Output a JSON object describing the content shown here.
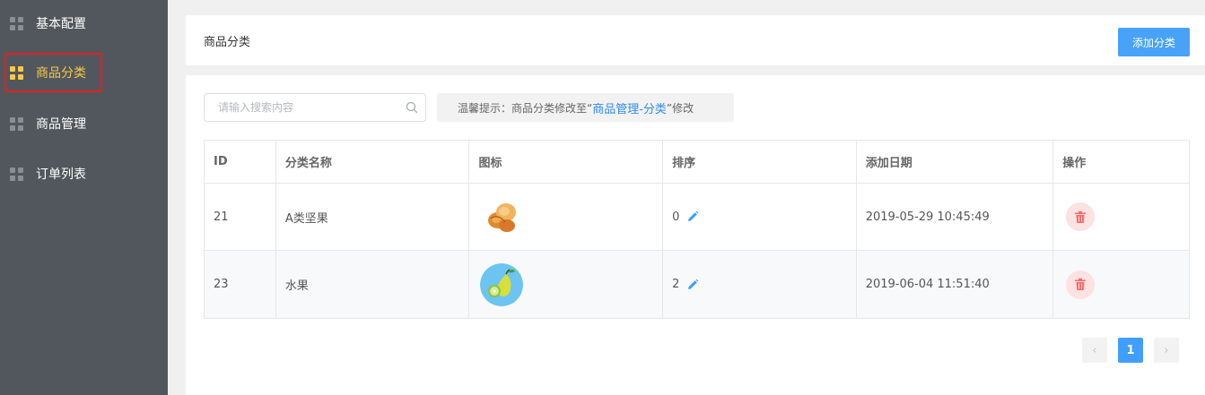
{
  "sidebar": {
    "items": [
      {
        "label": "基本配置",
        "active": false
      },
      {
        "label": "商品分类",
        "active": true
      },
      {
        "label": "商品管理",
        "active": false
      },
      {
        "label": "订单列表",
        "active": false
      }
    ]
  },
  "header": {
    "title": "商品分类",
    "add_button": "添加分类"
  },
  "search": {
    "placeholder": "请输入搜索内容",
    "value": ""
  },
  "tip": {
    "prefix": "温馨提示：商品分类修改至“",
    "link": "商品管理-分类",
    "suffix": "”修改"
  },
  "table": {
    "columns": [
      "ID",
      "分类名称",
      "图标",
      "排序",
      "添加日期",
      "操作"
    ],
    "rows": [
      {
        "id": "21",
        "name": "A类坚果",
        "icon": "nuts-icon",
        "sort": "0",
        "date": "2019-05-29 10:45:49"
      },
      {
        "id": "23",
        "name": "水果",
        "icon": "fruit-icon",
        "sort": "2",
        "date": "2019-06-04 11:51:40"
      }
    ]
  },
  "pagination": {
    "prev": "‹",
    "current": "1",
    "next": "›"
  },
  "colors": {
    "sidebar_bg": "#52575d",
    "active": "#f7c94a",
    "primary": "#48a2f7",
    "danger": "#f56c6c"
  }
}
